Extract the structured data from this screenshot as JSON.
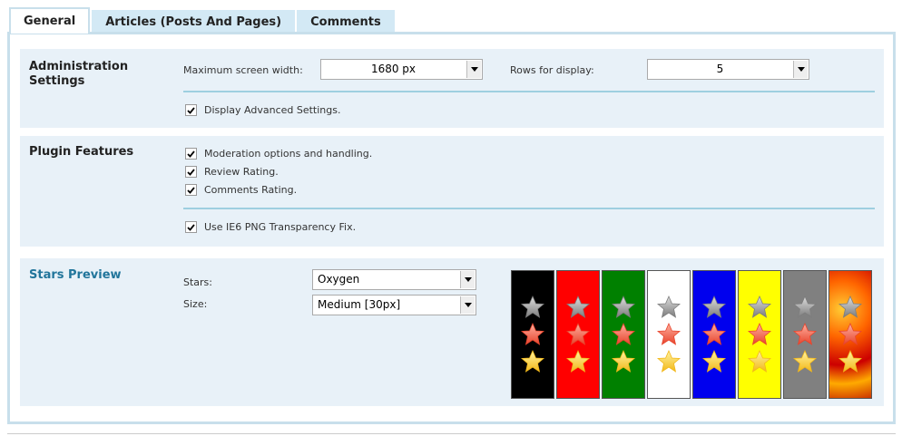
{
  "tabs": [
    {
      "label": "General",
      "active": true
    },
    {
      "label": "Articles (Posts And Pages)",
      "active": false
    },
    {
      "label": "Comments",
      "active": false
    }
  ],
  "admin": {
    "title_line1": "Administration",
    "title_line2": "Settings",
    "max_width_label": "Maximum screen width:",
    "max_width_value": "1680 px",
    "rows_label": "Rows for display:",
    "rows_value": "5",
    "advanced_label": "Display Advanced Settings."
  },
  "features": {
    "title": "Plugin Features",
    "items": [
      "Moderation options and handling.",
      "Review Rating.",
      "Comments Rating."
    ],
    "ie6_label": "Use IE6 PNG Transparency Fix."
  },
  "preview": {
    "title": "Stars Preview",
    "stars_label": "Stars:",
    "stars_value": "Oxygen",
    "size_label": "Size:",
    "size_value": "Medium [30px]"
  },
  "swatches": [
    "black",
    "red",
    "green",
    "white",
    "blue",
    "yellow",
    "gray",
    "flame"
  ],
  "colors": {
    "accent": "#21759b",
    "tab_bg": "#d3e9f5",
    "box_bg": "#e8f1f8",
    "divider": "#9ecfe0"
  }
}
